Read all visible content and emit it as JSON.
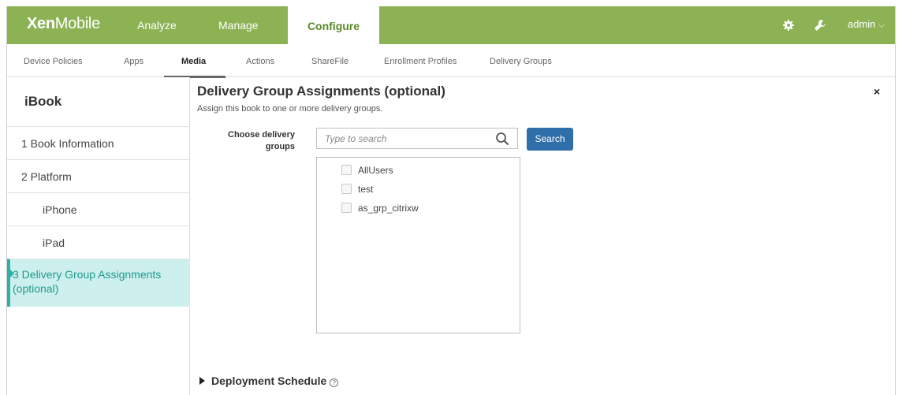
{
  "topnav": {
    "logo_bold": "Xen",
    "logo_rest": "Mobile",
    "items": [
      "Analyze",
      "Manage",
      "Configure"
    ],
    "user": "admin",
    "brand_color": "#8cb254"
  },
  "subnav": {
    "items": [
      "Device Policies",
      "Apps",
      "Media",
      "Actions",
      "ShareFile",
      "Enrollment Profiles",
      "Delivery Groups"
    ],
    "active": "Media"
  },
  "sidebar": {
    "title": "iBook",
    "items": [
      {
        "label": "1  Book Information"
      },
      {
        "label": "2  Platform"
      },
      {
        "label": "iPhone"
      },
      {
        "label": "iPad"
      },
      {
        "label": "3  Delivery Group Assignments (optional)"
      }
    ]
  },
  "main": {
    "title": "Delivery Group Assignments (optional)",
    "subtitle": "Assign this book to one or more delivery groups.",
    "field_label": "Choose delivery groups",
    "search_placeholder": "Type to search",
    "search_value": "",
    "search_button": "Search",
    "groups": [
      {
        "label": "AllUsers",
        "checked": false
      },
      {
        "label": "test",
        "checked": false
      },
      {
        "label": "as_grp_citrixw",
        "checked": false
      }
    ],
    "deployment_label": "Deployment Schedule",
    "help_glyph": "?",
    "close_glyph": "×"
  }
}
